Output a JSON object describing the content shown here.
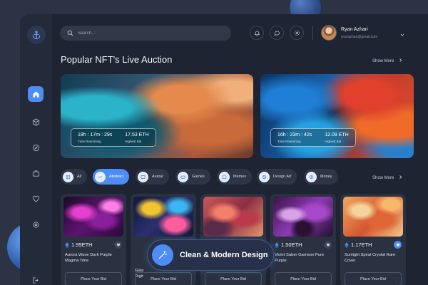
{
  "search": {
    "placeholder": "Search..."
  },
  "user": {
    "name": "Ryan Azhari",
    "email": "ryanazhari@gmail.com"
  },
  "auction": {
    "title": "Popular NFT's Live Auction",
    "show_more": "Show More",
    "items": [
      {
        "time": "18h : 17m : 29s",
        "time_label": "Time Reamining",
        "bid": "17.53 ETH",
        "bid_label": "Highest Bid"
      },
      {
        "time": "16h : 23m : 42s",
        "time_label": "Time Reamining",
        "bid": "12.09 ETH",
        "bid_label": "Highest Bid"
      }
    ]
  },
  "filters": {
    "show_more": "Show More",
    "items": [
      {
        "label": "All",
        "icon": "grid-icon",
        "active": false
      },
      {
        "label": "Abstract",
        "icon": "abstract-icon",
        "active": true
      },
      {
        "label": "Avatar",
        "icon": "avatar-icon",
        "active": false
      },
      {
        "label": "Games",
        "icon": "gamepad-icon",
        "active": false
      },
      {
        "label": "Memes",
        "icon": "meme-icon",
        "active": false
      },
      {
        "label": "Design Art",
        "icon": "design-icon",
        "active": false
      },
      {
        "label": "Money",
        "icon": "money-icon",
        "active": false
      }
    ]
  },
  "cards": [
    {
      "price": "1.99ETH",
      "name": "Aurora Wave Dark Purple Magma Tone",
      "button": "Place Your Bid",
      "liked": false
    },
    {
      "price": "",
      "name": "Gala Digit",
      "button": "Place Your Bid",
      "liked": false
    },
    {
      "price": "",
      "name": "",
      "button": "Place Your Bid",
      "liked": false
    },
    {
      "price": "1.50ETH",
      "name": "Violet Saber Garrison Pure Purple",
      "button": "Place Your Bid",
      "liked": false
    },
    {
      "price": "1.17ETH",
      "name": "Sunlight Spiral Crystal Rare Cover",
      "button": "Place Your Bid",
      "liked": true
    }
  ],
  "tooltip": {
    "text": "Clean & Modern Design"
  },
  "colors": {
    "accent": "#4d8cf5",
    "panel": "#1e2431",
    "card": "#2a3242",
    "background": "#2b3345"
  }
}
